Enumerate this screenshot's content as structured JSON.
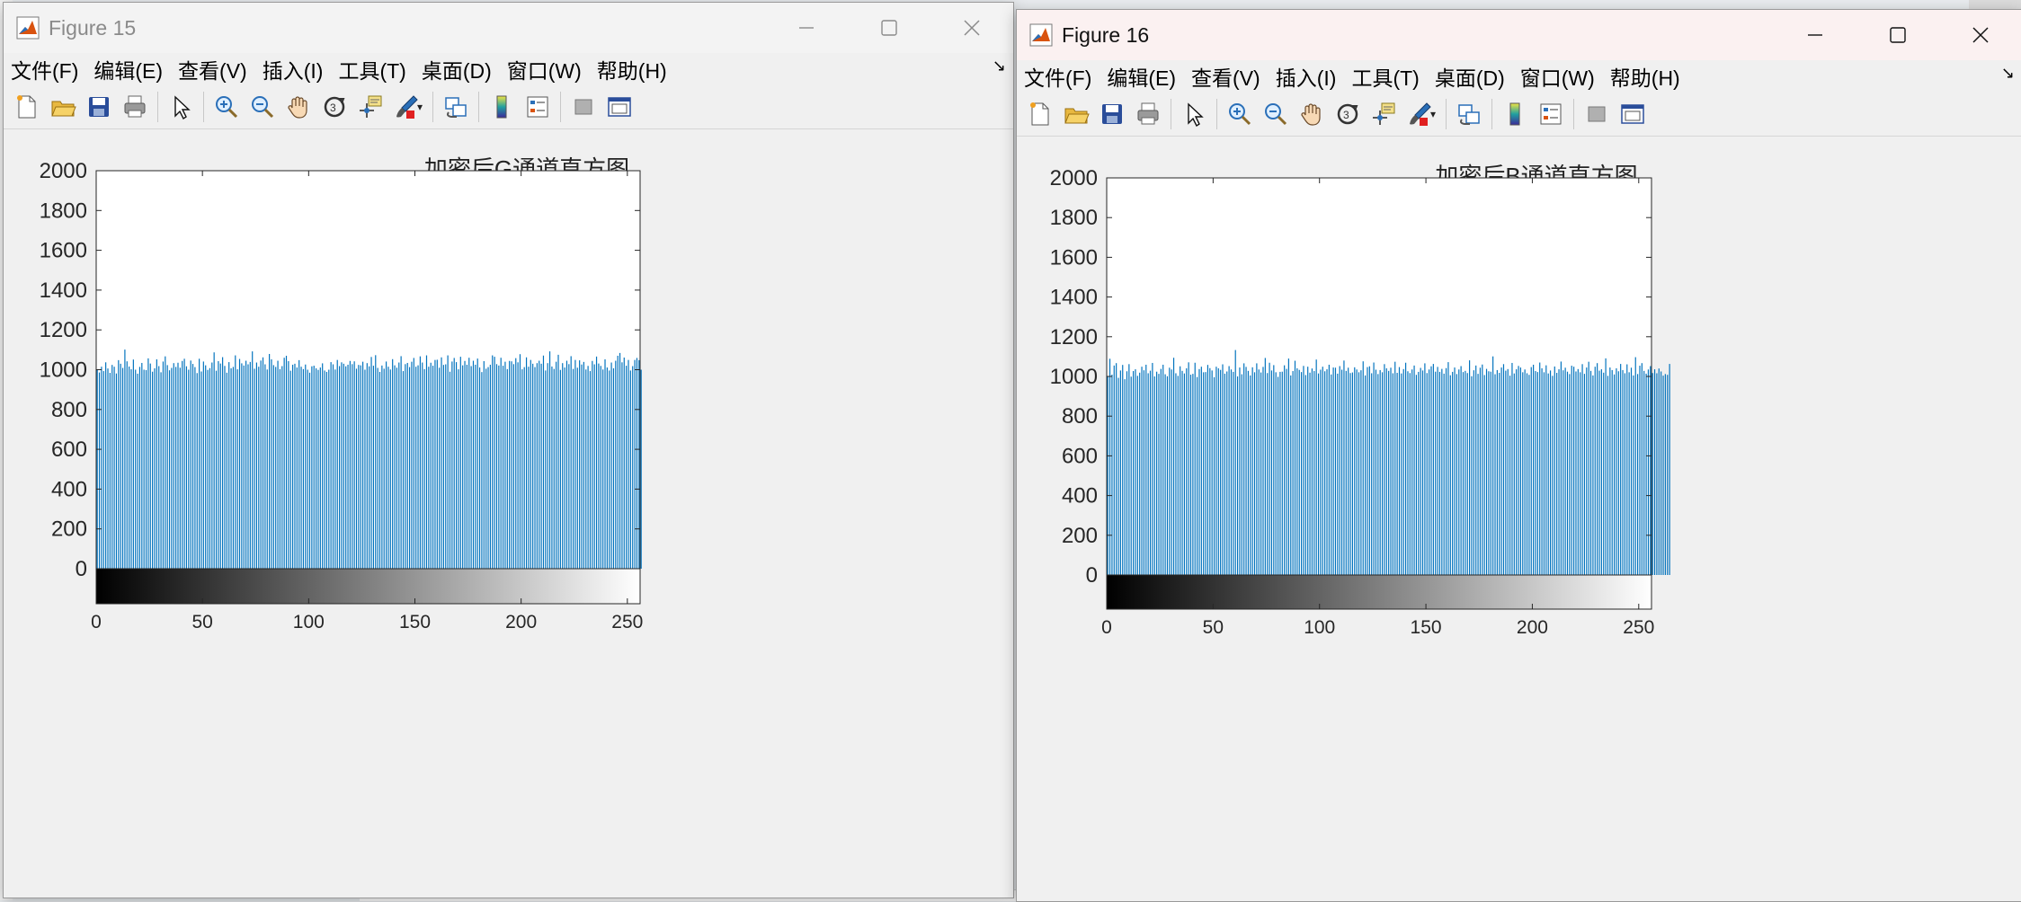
{
  "desktop": {},
  "windows": [
    {
      "id": "w1",
      "title": "Figure 15",
      "active": false,
      "menu": [
        "文件(F)",
        "编辑(E)",
        "查看(V)",
        "插入(I)",
        "工具(T)",
        "桌面(D)",
        "窗口(W)",
        "帮助(H)"
      ],
      "chart_data": {
        "type": "bar",
        "title": "加密后G通道直方图",
        "xlabel": "",
        "ylabel": "",
        "xlim": [
          0,
          255
        ],
        "ylim": [
          0,
          2000
        ],
        "xticks": [
          0,
          50,
          100,
          150,
          200,
          250
        ],
        "yticks": [
          0,
          200,
          400,
          600,
          800,
          1000,
          1200,
          1400,
          1600,
          1800,
          2000
        ],
        "bar_color": "#0072bd",
        "colorbar": "gray",
        "values": [
          1000,
          986,
          1015,
          993,
          1037,
          1006,
          984,
          1024,
          1015,
          981,
          1048,
          1030,
          1009,
          1101,
          1042,
          1016,
          1002,
          1051,
          1000,
          980,
          1014,
          1034,
          1000,
          998,
          1057,
          1031,
          990,
          1007,
          1052,
          1018,
          987,
          1041,
          1067,
          1023,
          997,
          1009,
          1033,
          1014,
          1035,
          1010,
          1044,
          1055,
          1017,
          1000,
          1046,
          1029,
          1013,
          983,
          1055,
          991,
          1041,
          1022,
          999,
          1008,
          1036,
          1087,
          995,
          1043,
          1031,
          1063,
          1019,
          985,
          1038,
          1007,
          1014,
          1072,
          1002,
          1054,
          1032,
          1021,
          1045,
          1027,
          1039,
          1092,
          1005,
          1036,
          1015,
          1046,
          1062,
          1027,
          1001,
          1079,
          1052,
          1023,
          1014,
          1045,
          1003,
          1018,
          1060,
          1070,
          1043,
          995,
          1025,
          1030,
          1011,
          1048,
          1015,
          1003,
          1026,
          1000,
          985,
          1017,
          1020,
          1007,
          999,
          1011,
          1032,
          996,
          989,
          1000,
          1038,
          1027,
          1001,
          1049,
          1018,
          1037,
          1030,
          1017,
          1025,
          1044,
          1028,
          1042,
          1005,
          1024,
          1022,
          1040,
          1000,
          1033,
          1017,
          1064,
          1020,
          1073,
          1009,
          989,
          1021,
          1005,
          1041,
          1015,
          1001,
          1053,
          1022,
          1010,
          1036,
          1068,
          993,
          1028,
          1034,
          1013,
          1040,
          1059,
          1015,
          1022,
          1067,
          1036,
          1003,
          1072,
          1015,
          1035,
          1020,
          1049,
          1050,
          1010,
          1062,
          1024,
          1027,
          1072,
          990,
          1041,
          1059,
          1038,
          1002,
          1065,
          1022,
          1044,
          1025,
          1060,
          1018,
          1045,
          1025,
          1056,
          1011,
          988,
          1043,
          1005,
          1013,
          1025,
          1072,
          1065,
          1028,
          1021,
          1060,
          1020,
          1040,
          1003,
          1044,
          1042,
          1028,
          1058,
          1037,
          1078,
          1002,
          1013,
          1062,
          1015,
          1049,
          1030,
          1013,
          1033,
          1045,
          1030,
          1071,
          996,
          1033,
          1092,
          1016,
          1004,
          1040,
          1075,
          999,
          1033,
          1011,
          1045,
          1028,
          1068,
          1004,
          1049,
          1010,
          1047,
          1026,
          1039,
          1001,
          1019,
          993,
          1044,
          1027,
          1066,
          1031,
          1019,
          1001,
          1052,
          1011,
          996,
          1036,
          1007,
          1045,
          1070,
          1084,
          1037,
          1061,
          1020,
          1049,
          996,
          1018,
          1049,
          1059,
          1048,
          1000
        ],
        "value_note": ""
      }
    },
    {
      "id": "w2",
      "title": "Figure 16",
      "active": true,
      "menu": [
        "文件(F)",
        "编辑(E)",
        "查看(V)",
        "插入(I)",
        "工具(T)",
        "桌面(D)",
        "窗口(W)",
        "帮助(H)"
      ],
      "chart_data": {
        "type": "bar",
        "title": "加密后B通道直方图",
        "xlabel": "",
        "ylabel": "",
        "xlim": [
          0,
          255
        ],
        "ylim": [
          0,
          2000
        ],
        "xticks": [
          0,
          50,
          100,
          150,
          200,
          250
        ],
        "yticks": [
          0,
          200,
          400,
          600,
          800,
          1000,
          1200,
          1400,
          1600,
          1800,
          2000
        ],
        "bar_color": "#0072bd",
        "colorbar": "gray",
        "values": [
          1002,
          1089,
          1009,
          1055,
          1067,
          993,
          1030,
          1058,
          986,
          1026,
          1062,
          999,
          1027,
          1036,
          1003,
          1019,
          1049,
          1031,
          1059,
          1016,
          1029,
          1068,
          1000,
          1024,
          1013,
          1038,
          1059,
          1011,
          1001,
          1044,
          1035,
          1094,
          1016,
          1003,
          1051,
          1028,
          1015,
          1041,
          1071,
          1009,
          1013,
          1069,
          997,
          1037,
          1049,
          1021,
          1022,
          1058,
          1042,
          1030,
          996,
          1049,
          1041,
          1033,
          1061,
          1014,
          1025,
          1052,
          1035,
          1023,
          1133,
          1000,
          1045,
          1011,
          1066,
          1048,
          1028,
          1005,
          1046,
          1021,
          1066,
          1035,
          1020,
          1048,
          1093,
          1017,
          1069,
          1030,
          1057,
          1021,
          998,
          1023,
          1024,
          1056,
          1038,
          1090,
          1005,
          1027,
          1079,
          1041,
          1033,
          1022,
          1053,
          1007,
          1049,
          1019,
          1040,
          1027,
          1085,
          1015,
          1034,
          1049,
          1026,
          1036,
          1059,
          1010,
          1045,
          1044,
          1014,
          1052,
          1034,
          1080,
          1028,
          1044,
          1017,
          1020,
          1046,
          1035,
          1021,
          1031,
          1076,
          1005,
          1047,
          1051,
          1016,
          1070,
          1034,
          1012,
          1032,
          1021,
          1062,
          1041,
          1028,
          1044,
          1016,
          1074,
          1018,
          1047,
          1015,
          1037,
          1069,
          1026,
          1017,
          1035,
          1055,
          1008,
          1023,
          1043,
          1030,
          1066,
          1017,
          1035,
          1051,
          1063,
          1024,
          1048,
          1023,
          1038,
          1014,
          1042,
          1072,
          1006,
          1023,
          1045,
          1012,
          1035,
          1052,
          1022,
          1028,
          1017,
          1081,
          1001,
          1031,
          1055,
          1013,
          1044,
          1060,
          1007,
          1038,
          1026,
          1024,
          1101,
          1011,
          1032,
          1018,
          1045,
          1062,
          1029,
          1037,
          1004,
          1068,
          1015,
          1036,
          1053,
          1045,
          1021,
          1035,
          1016,
          1008,
          1047,
          1059,
          1027,
          1022,
          1070,
          1041,
          1021,
          1056,
          1015,
          1030,
          1003,
          1050,
          1018,
          1036,
          1075,
          1031,
          1044,
          1024,
          1012,
          1054,
          1049,
          1025,
          1037,
          1021,
          1062,
          1013,
          1045,
          1074,
          1028,
          1005,
          1049,
          1067,
          1029,
          1036,
          1019,
          1091,
          1003,
          1045,
          1032,
          1010,
          1041,
          1026,
          1063,
          1032,
          1016,
          1061,
          1021,
          1044,
          1005,
          1097,
          1012,
          1054,
          1067,
          1028,
          1014,
          1035,
          1052,
          1017,
          1036,
          1016,
          1040,
          1025,
          1004,
          1012,
          1008,
          1063
        ]
      }
    }
  ],
  "icons": [
    "new-file-icon",
    "open-folder-icon",
    "save-icon",
    "print-icon",
    "select-arrow-icon",
    "zoom-in-icon",
    "zoom-out-icon",
    "pan-hand-icon",
    "rotate-3d-icon",
    "data-cursor-icon",
    "brush-icon",
    "link-plot-icon",
    "colorbar-icon",
    "legend-icon",
    "hide-plot-tools-icon",
    "show-plot-tools-icon"
  ]
}
